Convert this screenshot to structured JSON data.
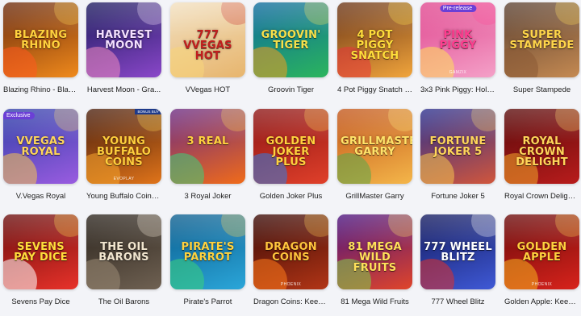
{
  "games": [
    {
      "label": "Blazing Rhino - Blast...",
      "art_title": "Blazing Rhino",
      "provider": "",
      "bg": [
        "#6b2a0c",
        "#f08a1c"
      ],
      "title_color": "#ffd23e",
      "accent": "#ff5a1f"
    },
    {
      "label": "Harvest Moon - Gra...",
      "art_title": "Harvest Moon",
      "provider": "",
      "bg": [
        "#1c1a5e",
        "#8a47c9"
      ],
      "title_color": "#f4e0ff",
      "accent": "#f08ac0"
    },
    {
      "label": "VVegas HOT",
      "art_title": "777 VVegas HOT",
      "provider": "",
      "bg": [
        "#f2e0c0",
        "#e7b56d"
      ],
      "title_color": "#c21e1e",
      "accent": "#f7d67a"
    },
    {
      "label": "Groovin Tiger",
      "art_title": "Groovin' Tiger",
      "provider": "",
      "bg": [
        "#0e6a9e",
        "#2bb55d"
      ],
      "title_color": "#f8e04a",
      "accent": "#f29c1d"
    },
    {
      "label": "4 Pot Piggy Snatch H...",
      "art_title": "4 Pot Piggy Snatch",
      "provider": "",
      "bg": [
        "#6a3416",
        "#f1a53c"
      ],
      "title_color": "#ffde3b",
      "accent": "#e8353a"
    },
    {
      "label": "3x3 Pink Piggy: Hold...",
      "art_title": "Pink Piggy",
      "provider": "GAMZIX",
      "bg": [
        "#e0458e",
        "#f4a1c8"
      ],
      "title_color": "#ff3d8f",
      "accent": "#ffe05a",
      "badge": "Pre-release",
      "badge_color": "#6b3fd6"
    },
    {
      "label": "Super Stampede",
      "art_title": "Super Stampede",
      "provider": "",
      "bg": [
        "#5a4031",
        "#c58a52"
      ],
      "title_color": "#ffd64a",
      "accent": "#8a5a35"
    },
    {
      "label": "V.Vegas Royal",
      "art_title": "VVegas Royal",
      "provider": "",
      "bg": [
        "#2f3fa8",
        "#9a5ce0"
      ],
      "title_color": "#ffd65a",
      "accent": "#f5c44e",
      "badge": "Exclusive",
      "badge_color": "#6b3fd6"
    },
    {
      "label": "Young Buffalo Coins...",
      "art_title": "Young Buffalo Coins",
      "provider": "EVOPLAY",
      "bg": [
        "#4a1e0c",
        "#e0741a"
      ],
      "title_color": "#ffcf3d",
      "accent": "#f8a52e",
      "corner_badge": "Bonus Buy"
    },
    {
      "label": "3 Royal Joker",
      "art_title": "3 Real",
      "provider": "",
      "bg": [
        "#6b2a82",
        "#f06b1a"
      ],
      "title_color": "#ffd23e",
      "accent": "#3bd17a"
    },
    {
      "label": "Golden Joker Plus",
      "art_title": "Golden Joker Plus",
      "provider": "",
      "bg": [
        "#8c1414",
        "#e0402a"
      ],
      "title_color": "#ffd23e",
      "accent": "#2f7be0"
    },
    {
      "label": "GrillMaster Garry",
      "art_title": "GrillMaster Garry",
      "provider": "",
      "bg": [
        "#c2551a",
        "#f4b64a"
      ],
      "title_color": "#ffe36a",
      "accent": "#5aa84a"
    },
    {
      "label": "Fortune Joker 5",
      "art_title": "Fortune Joker 5",
      "provider": "",
      "bg": [
        "#2a2f8e",
        "#d1563c"
      ],
      "title_color": "#ffd65a",
      "accent": "#f5c44e"
    },
    {
      "label": "Royal Crown Delight...",
      "art_title": "Royal Crown Delight",
      "provider": "",
      "bg": [
        "#5a0a0a",
        "#b81c1c"
      ],
      "title_color": "#ffd65a",
      "accent": "#f3a72a"
    },
    {
      "label": "Sevens Pay Dice",
      "art_title": "Sevens Pay Dice",
      "provider": "",
      "bg": [
        "#6a0d0d",
        "#e8322a"
      ],
      "title_color": "#ffde3b",
      "accent": "#ffffff"
    },
    {
      "label": "The Oil Barons",
      "art_title": "The Oil Barons",
      "provider": "",
      "bg": [
        "#2b241d",
        "#6f6152"
      ],
      "title_color": "#f2e6cf",
      "accent": "#9a8a74"
    },
    {
      "label": "Pirate's Parrot",
      "art_title": "Pirate's Parrot",
      "provider": "",
      "bg": [
        "#0b5d8e",
        "#2ba6d9"
      ],
      "title_color": "#ffd23e",
      "accent": "#3bd17a"
    },
    {
      "label": "Dragon Coins: Keep ...",
      "art_title": "Dragon Coins",
      "provider": "PHOENIX",
      "bg": [
        "#3a0a06",
        "#b23516"
      ],
      "title_color": "#ffc53d",
      "accent": "#ff7a1a"
    },
    {
      "label": "81 Mega Wild Fruits",
      "art_title": "81 Mega Wild Fruits",
      "provider": "",
      "bg": [
        "#4a1380",
        "#e0452a"
      ],
      "title_color": "#ffe15a",
      "accent": "#7ed14a"
    },
    {
      "label": "777 Wheel Blitz",
      "art_title": "777 Wheel Blitz",
      "provider": "",
      "bg": [
        "#131a5e",
        "#3f59d6"
      ],
      "title_color": "#ffffff",
      "accent": "#e0302a"
    },
    {
      "label": "Golden Apple: Keep ...",
      "art_title": "Golden Apple",
      "provider": "PHOENIX",
      "bg": [
        "#6a0a0a",
        "#d8231c"
      ],
      "title_color": "#ffd23e",
      "accent": "#f8b51d"
    }
  ]
}
